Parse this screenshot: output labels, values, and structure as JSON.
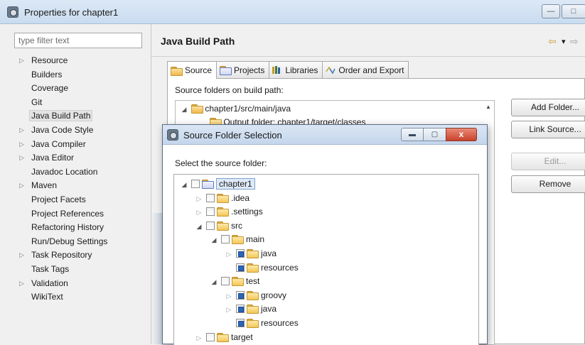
{
  "window": {
    "title": "Properties for chapter1",
    "buttons": {
      "minimize": "—",
      "maximize": "□"
    }
  },
  "sidebar": {
    "filter_placeholder": "type filter text",
    "items": [
      {
        "label": "Resource",
        "expandable": true
      },
      {
        "label": "Builders",
        "expandable": false
      },
      {
        "label": "Coverage",
        "expandable": false
      },
      {
        "label": "Git",
        "expandable": false
      },
      {
        "label": "Java Build Path",
        "expandable": false,
        "selected": true
      },
      {
        "label": "Java Code Style",
        "expandable": true
      },
      {
        "label": "Java Compiler",
        "expandable": true
      },
      {
        "label": "Java Editor",
        "expandable": true
      },
      {
        "label": "Javadoc Location",
        "expandable": false
      },
      {
        "label": "Maven",
        "expandable": true
      },
      {
        "label": "Project Facets",
        "expandable": false
      },
      {
        "label": "Project References",
        "expandable": false
      },
      {
        "label": "Refactoring History",
        "expandable": false
      },
      {
        "label": "Run/Debug Settings",
        "expandable": false
      },
      {
        "label": "Task Repository",
        "expandable": true
      },
      {
        "label": "Task Tags",
        "expandable": false
      },
      {
        "label": "Validation",
        "expandable": true
      },
      {
        "label": "WikiText",
        "expandable": false
      }
    ]
  },
  "main": {
    "title": "Java Build Path",
    "nav": {
      "back": "⇦",
      "menu": "▾",
      "forward": "⇨"
    },
    "tabs": [
      {
        "label": "Source",
        "icon": "source-folder-icon",
        "active": true
      },
      {
        "label": "Projects",
        "icon": "projects-icon",
        "active": false
      },
      {
        "label": "Libraries",
        "icon": "libraries-icon",
        "active": false
      },
      {
        "label": "Order and Export",
        "icon": "order-export-icon",
        "active": false
      }
    ],
    "source_label": "Source folders on build path:",
    "source_tree": [
      {
        "label": "chapter1/src/main/java",
        "expanded": true
      },
      {
        "label": "Output folder: chapter1/target/classes"
      }
    ],
    "buttons": {
      "add_folder": "Add Folder...",
      "link_source": "Link Source...",
      "edit": "Edit...",
      "remove": "Remove"
    }
  },
  "dialog": {
    "title": "Source Folder Selection",
    "close_label": "x",
    "instruction": "Select the source folder:",
    "tree": [
      {
        "label": "chapter1",
        "depth": 0,
        "expanded": true,
        "checked": "none",
        "kind": "project",
        "highlighted": true
      },
      {
        "label": ".idea",
        "depth": 1,
        "expanded": false,
        "checked": "none"
      },
      {
        "label": ".settings",
        "depth": 1,
        "expanded": false,
        "checked": "none"
      },
      {
        "label": "src",
        "depth": 1,
        "expanded": true,
        "checked": "none"
      },
      {
        "label": "main",
        "depth": 2,
        "expanded": true,
        "checked": "none"
      },
      {
        "label": "java",
        "depth": 3,
        "expanded": false,
        "checked": "partial"
      },
      {
        "label": "resources",
        "depth": 3,
        "expanded": null,
        "checked": "partial"
      },
      {
        "label": "test",
        "depth": 2,
        "expanded": true,
        "checked": "none"
      },
      {
        "label": "groovy",
        "depth": 3,
        "expanded": false,
        "checked": "partial"
      },
      {
        "label": "java",
        "depth": 3,
        "expanded": false,
        "checked": "partial"
      },
      {
        "label": "resources",
        "depth": 3,
        "expanded": null,
        "checked": "partial"
      },
      {
        "label": "target",
        "depth": 1,
        "expanded": false,
        "checked": "none"
      }
    ]
  }
}
